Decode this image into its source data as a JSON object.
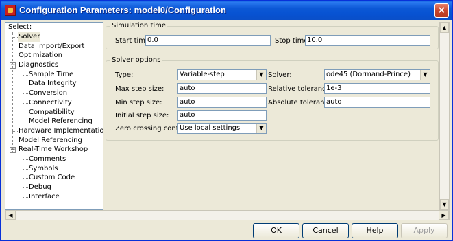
{
  "window": {
    "title": "Configuration Parameters: model0/Configuration",
    "close_label": "×"
  },
  "tree": {
    "header": "Select:",
    "items": [
      {
        "label": "Solver",
        "level": 1,
        "selected": true
      },
      {
        "label": "Data Import/Export",
        "level": 1
      },
      {
        "label": "Optimization",
        "level": 1
      },
      {
        "label": "Diagnostics",
        "level": 1,
        "expanded": true
      },
      {
        "label": "Sample Time",
        "level": 2
      },
      {
        "label": "Data Integrity",
        "level": 2
      },
      {
        "label": "Conversion",
        "level": 2
      },
      {
        "label": "Connectivity",
        "level": 2
      },
      {
        "label": "Compatibility",
        "level": 2
      },
      {
        "label": "Model Referencing",
        "level": 2
      },
      {
        "label": "Hardware Implementation",
        "level": 1
      },
      {
        "label": "Model Referencing",
        "level": 1
      },
      {
        "label": "Real-Time Workshop",
        "level": 1,
        "expanded": true
      },
      {
        "label": "Comments",
        "level": 2
      },
      {
        "label": "Symbols",
        "level": 2
      },
      {
        "label": "Custom Code",
        "level": 2
      },
      {
        "label": "Debug",
        "level": 2
      },
      {
        "label": "Interface",
        "level": 2
      }
    ]
  },
  "simulation_time": {
    "title": "Simulation time",
    "start_label": "Start time:",
    "start_value": "0.0",
    "stop_label": "Stop time:",
    "stop_value": "10.0"
  },
  "solver_options": {
    "title": "Solver options",
    "type_label": "Type:",
    "type_value": "Variable-step",
    "solver_label": "Solver:",
    "solver_value": "ode45 (Dormand-Prince)",
    "max_step_label": "Max step size:",
    "max_step_value": "auto",
    "rel_tol_label": "Relative tolerance:",
    "rel_tol_value": "1e-3",
    "min_step_label": "Min step size:",
    "min_step_value": "auto",
    "abs_tol_label": "Absolute tolerance:",
    "abs_tol_value": "auto",
    "initial_step_label": "Initial step size:",
    "initial_step_value": "auto",
    "zero_crossing_label": "Zero crossing control:",
    "zero_crossing_value": "Use local settings"
  },
  "buttons": {
    "ok": "OK",
    "cancel": "Cancel",
    "help": "Help",
    "apply": "Apply"
  }
}
